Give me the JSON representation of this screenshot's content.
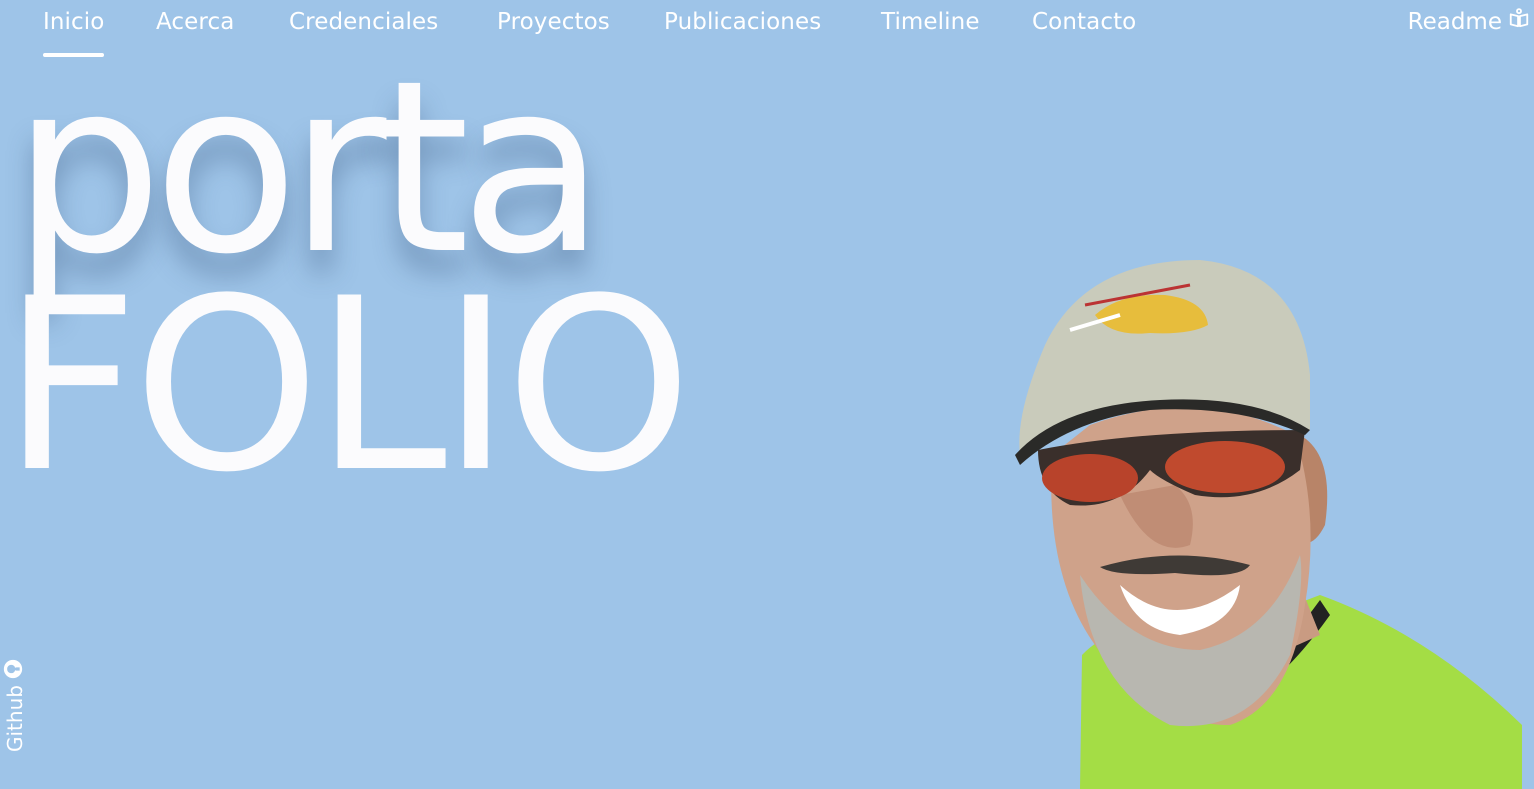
{
  "nav": {
    "items": [
      {
        "label": "Inicio",
        "active": true
      },
      {
        "label": "Acerca"
      },
      {
        "label": "Credenciales"
      },
      {
        "label": "Proyectos"
      },
      {
        "label": "Publicaciones"
      },
      {
        "label": "Timeline"
      },
      {
        "label": "Contacto"
      }
    ],
    "readme": {
      "label": "Readme",
      "icon": "open-book-icon"
    }
  },
  "hero": {
    "line1": "porta",
    "line2": "FOLIO"
  },
  "github": {
    "label": "Github",
    "icon": "github-icon"
  },
  "portrait": {
    "icon": "avatar-photo"
  },
  "colors": {
    "background": "#9ec4e8",
    "text": "#ffffff",
    "shirt": "#a4dd45",
    "cap": "#c9cbbb"
  }
}
